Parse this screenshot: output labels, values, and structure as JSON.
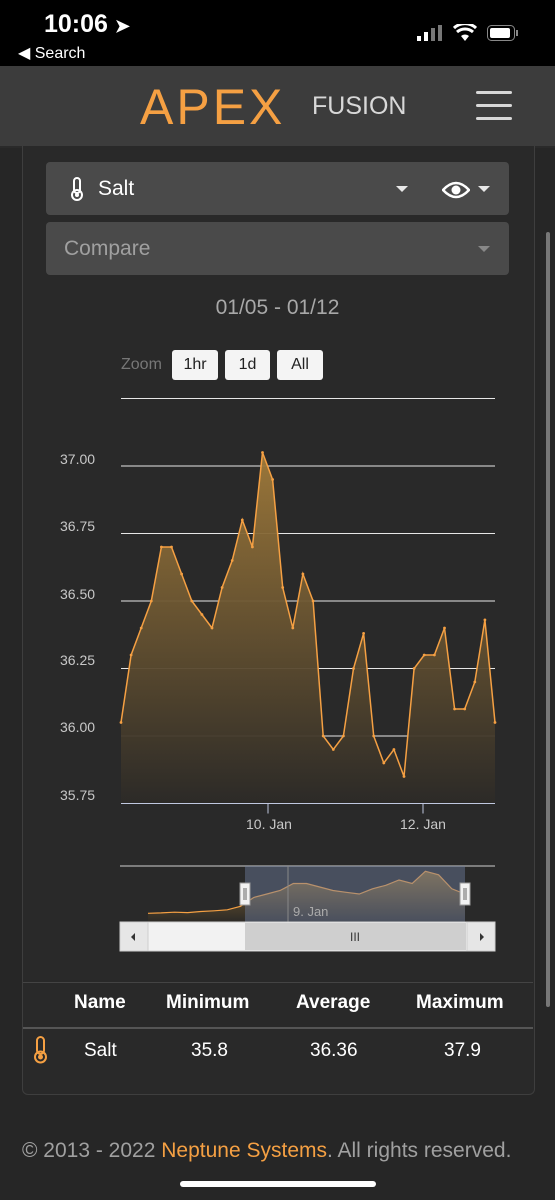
{
  "status": {
    "time": "10:06",
    "back_label": "◀ Search"
  },
  "header": {
    "logo_main": "APEX",
    "logo_sub": "FUSION"
  },
  "probe_select": {
    "value": "Salt"
  },
  "compare_select": {
    "placeholder": "Compare"
  },
  "date_range": "01/05 - 01/12",
  "zoom": {
    "label": "Zoom",
    "options": [
      "1hr",
      "1d",
      "All"
    ]
  },
  "chart_data": {
    "type": "area",
    "series": [
      {
        "name": "Salt",
        "color": "#f5a043",
        "x": [
          "01/05",
          "01/05",
          "01/05",
          "01/06",
          "01/06",
          "01/06",
          "01/06",
          "01/07",
          "01/07",
          "01/07",
          "01/07",
          "01/07",
          "01/08",
          "01/08",
          "01/08",
          "01/08",
          "01/08",
          "01/08",
          "01/08",
          "01/09",
          "01/09",
          "01/09",
          "01/09",
          "01/09",
          "01/10",
          "01/10",
          "01/10",
          "01/10",
          "01/10",
          "01/11",
          "01/11",
          "01/11",
          "01/11",
          "01/11",
          "01/12",
          "01/12",
          "01/12",
          "01/12"
        ],
        "values": [
          36.05,
          36.3,
          36.4,
          36.5,
          36.7,
          36.7,
          36.6,
          36.5,
          36.45,
          36.4,
          36.55,
          36.65,
          36.8,
          36.7,
          37.05,
          36.95,
          36.55,
          36.4,
          36.6,
          36.5,
          36.0,
          35.95,
          36.0,
          36.25,
          36.38,
          36.0,
          35.9,
          35.95,
          35.85,
          36.25,
          36.3,
          36.3,
          36.4,
          36.1,
          36.1,
          36.2,
          36.43,
          36.05
        ]
      }
    ],
    "y_ticks": [
      "37.00",
      "36.75",
      "36.50",
      "36.25",
      "36.00",
      "35.75"
    ],
    "ylim": [
      35.75,
      37.25
    ],
    "x_ticks": [
      "10. Jan",
      "12. Jan"
    ],
    "navigator_label": "9. Jan",
    "navigator_scrollbar_glyph": "III",
    "grid": true
  },
  "table": {
    "headers": [
      "Name",
      "Minimum",
      "Average",
      "Maximum"
    ],
    "row": {
      "name": "Salt",
      "min": "35.8",
      "avg": "36.36",
      "max": "37.9"
    }
  },
  "footer": {
    "prefix": "© 2013 - 2022 ",
    "brand": "Neptune Systems",
    "suffix": ". All rights reserved."
  }
}
